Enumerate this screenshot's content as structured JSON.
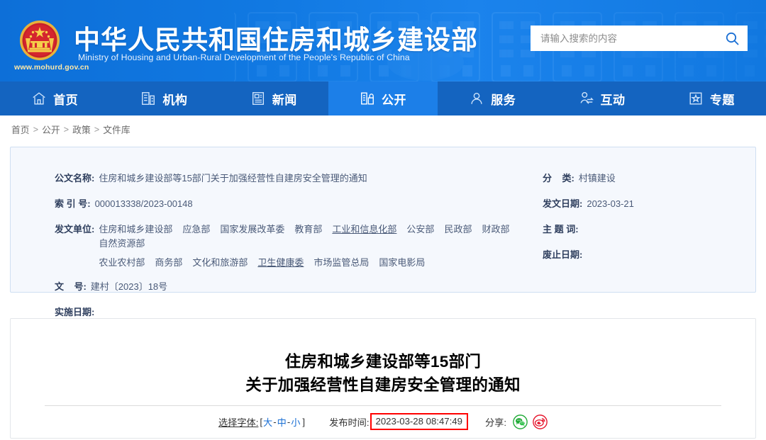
{
  "header": {
    "emblem_icon": "china-national-emblem",
    "site_url": "www.mohurd.gov.cn",
    "title_cn": "中华人民共和国住房和城乡建设部",
    "title_en": "Ministry of Housing and Urban-Rural Development of the People's Republic of China",
    "search": {
      "placeholder": "请输入搜索的内容",
      "value": "",
      "icon": "search-icon"
    },
    "bg_color": "#1277e0"
  },
  "nav": {
    "bg_color": "#1464c0",
    "active_color": "#1c7fe8",
    "items": [
      {
        "label": "首页",
        "icon": "home-icon",
        "active": false
      },
      {
        "label": "机构",
        "icon": "building-icon",
        "active": false
      },
      {
        "label": "新闻",
        "icon": "newspaper-icon",
        "active": false
      },
      {
        "label": "公开",
        "icon": "open-folder-icon",
        "active": true
      },
      {
        "label": "服务",
        "icon": "user-service-icon",
        "active": false
      },
      {
        "label": "互动",
        "icon": "interaction-icon",
        "active": false
      },
      {
        "label": "专题",
        "icon": "star-box-icon",
        "active": false
      }
    ]
  },
  "breadcrumb": {
    "items": [
      "首页",
      "公开",
      "政策",
      "文件库"
    ],
    "separator": ">"
  },
  "meta": {
    "doc_name_label": "公文名称:",
    "doc_name_value": "住房和城乡建设部等15部门关于加强经营性自建房安全管理的通知",
    "index_label": "索 引 号:",
    "index_value": "000013338/2023-00148",
    "issuer_label": "发文单位:",
    "issuer_line1": [
      {
        "name": "住房和城乡建设部",
        "link": false
      },
      {
        "name": "应急部",
        "link": false
      },
      {
        "name": "国家发展改革委",
        "link": false
      },
      {
        "name": "教育部",
        "link": false
      },
      {
        "name": "工业和信息化部",
        "link": true
      },
      {
        "name": "公安部",
        "link": false
      },
      {
        "name": "民政部",
        "link": false
      },
      {
        "name": "财政部",
        "link": false
      },
      {
        "name": "自然资源部",
        "link": false
      }
    ],
    "issuer_line2": [
      {
        "name": "农业农村部",
        "link": false
      },
      {
        "name": "商务部",
        "link": false
      },
      {
        "name": "文化和旅游部",
        "link": false
      },
      {
        "name": "卫生健康委",
        "link": true
      },
      {
        "name": "市场监管总局",
        "link": false
      },
      {
        "name": "国家电影局",
        "link": false
      }
    ],
    "docnum_label": "文    号:",
    "docnum_value": "建村〔2023〕18号",
    "effective_label": "实施日期:",
    "effective_value": "",
    "category_label": "分    类:",
    "category_value": "村镇建设",
    "issue_date_label": "发文日期:",
    "issue_date_value": "2023-03-21",
    "keywords_label": "主 题 词:",
    "keywords_value": "",
    "abolish_label": "废止日期:",
    "abolish_value": ""
  },
  "article": {
    "title_line1": "住房和城乡建设部等15部门",
    "title_line2": "关于加强经营性自建房安全管理的通知",
    "fontsize": {
      "label": "选择字体:",
      "open_bracket": "[",
      "close_bracket": "]",
      "large": "大",
      "medium": "中",
      "small": "小",
      "dash": "-"
    },
    "publish": {
      "label": "发布时间:",
      "value": "2023-03-28 08:47:49",
      "highlight_color": "#ff0000"
    },
    "share": {
      "label": "分享:",
      "items": [
        {
          "icon": "wechat-share-icon",
          "color": "#22ab38"
        },
        {
          "icon": "weibo-share-icon",
          "color": "#e6162d"
        }
      ]
    }
  }
}
